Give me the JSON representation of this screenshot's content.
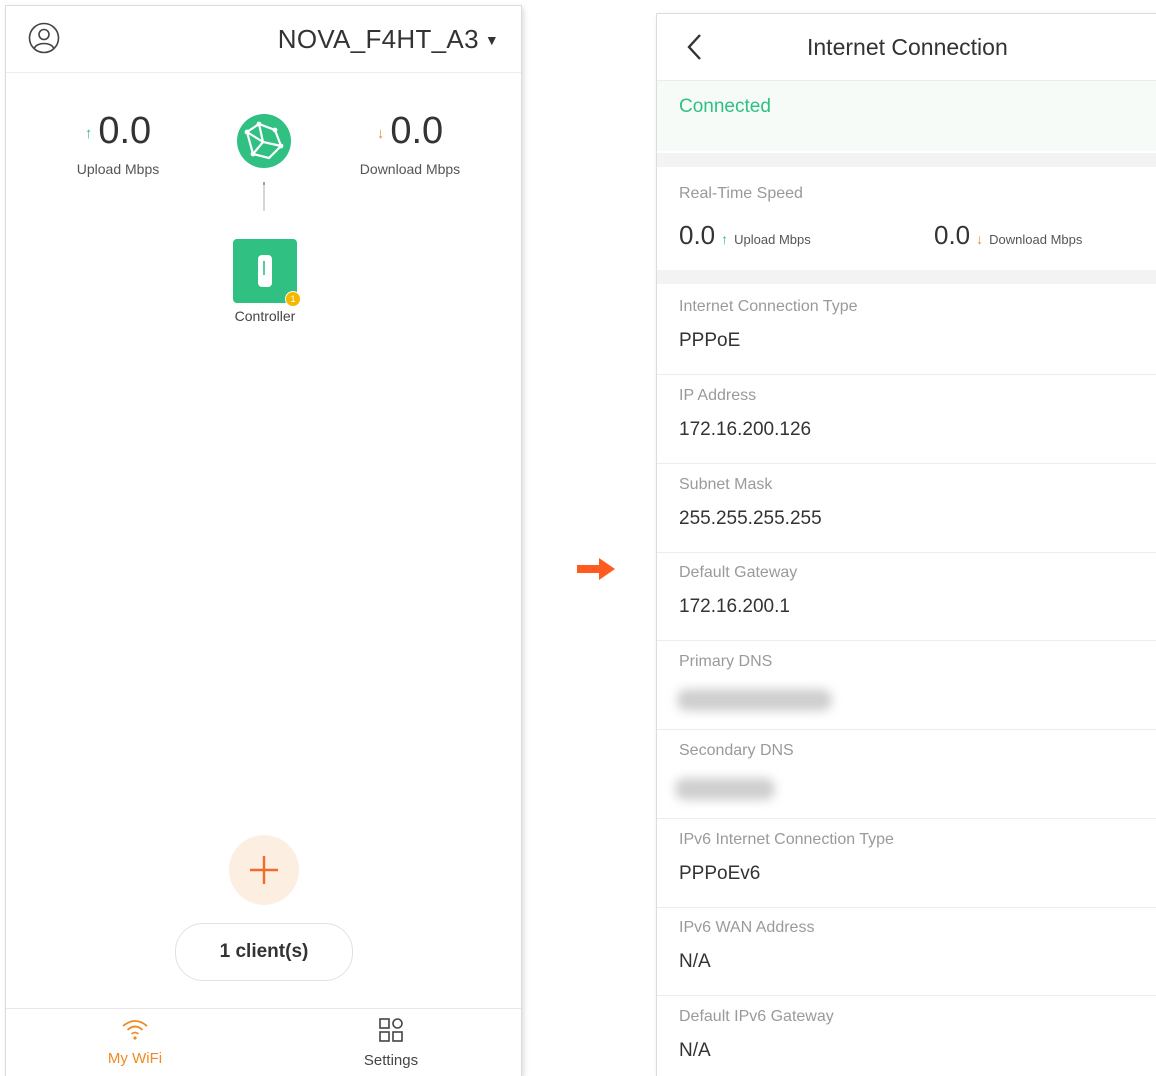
{
  "left_screen": {
    "ssid": "NOVA_F4HT_A3",
    "upload": {
      "value": "0.0",
      "label": "Upload Mbps",
      "arrow": "↑"
    },
    "download": {
      "value": "0.0",
      "label": "Download Mbps",
      "arrow": "↓"
    },
    "controller": {
      "label": "Controller",
      "badge": "1"
    },
    "clients_button": "1 client(s)",
    "nav": [
      {
        "label": "My WiFi",
        "icon": "wifi-icon",
        "active": true
      },
      {
        "label": "Settings",
        "icon": "grid-icon",
        "active": false
      }
    ]
  },
  "right_screen": {
    "title": "Internet Connection",
    "status": "Connected",
    "real_time_speed": {
      "title": "Real-Time Speed",
      "upload_value": "0.0",
      "upload_label": "Upload Mbps",
      "download_value": "0.0",
      "download_label": "Download Mbps"
    },
    "rows": [
      {
        "label": "Internet Connection Type",
        "value": "PPPoE"
      },
      {
        "label": "IP Address",
        "value": "172.16.200.126"
      },
      {
        "label": "Subnet Mask",
        "value": "255.255.255.255"
      },
      {
        "label": "Default Gateway",
        "value": "172.16.200.1"
      },
      {
        "label": "Primary DNS",
        "value": ""
      },
      {
        "label": "Secondary DNS",
        "value": ""
      },
      {
        "label": "IPv6 Internet Connection Type",
        "value": "PPPoEv6"
      },
      {
        "label": "IPv6 WAN Address",
        "value": "N/A"
      },
      {
        "label": "Default IPv6 Gateway",
        "value": "N/A"
      }
    ]
  },
  "colors": {
    "accent_green": "#2fc082",
    "accent_orange": "#f08a24",
    "flow_arrow": "#ff5a1f"
  }
}
